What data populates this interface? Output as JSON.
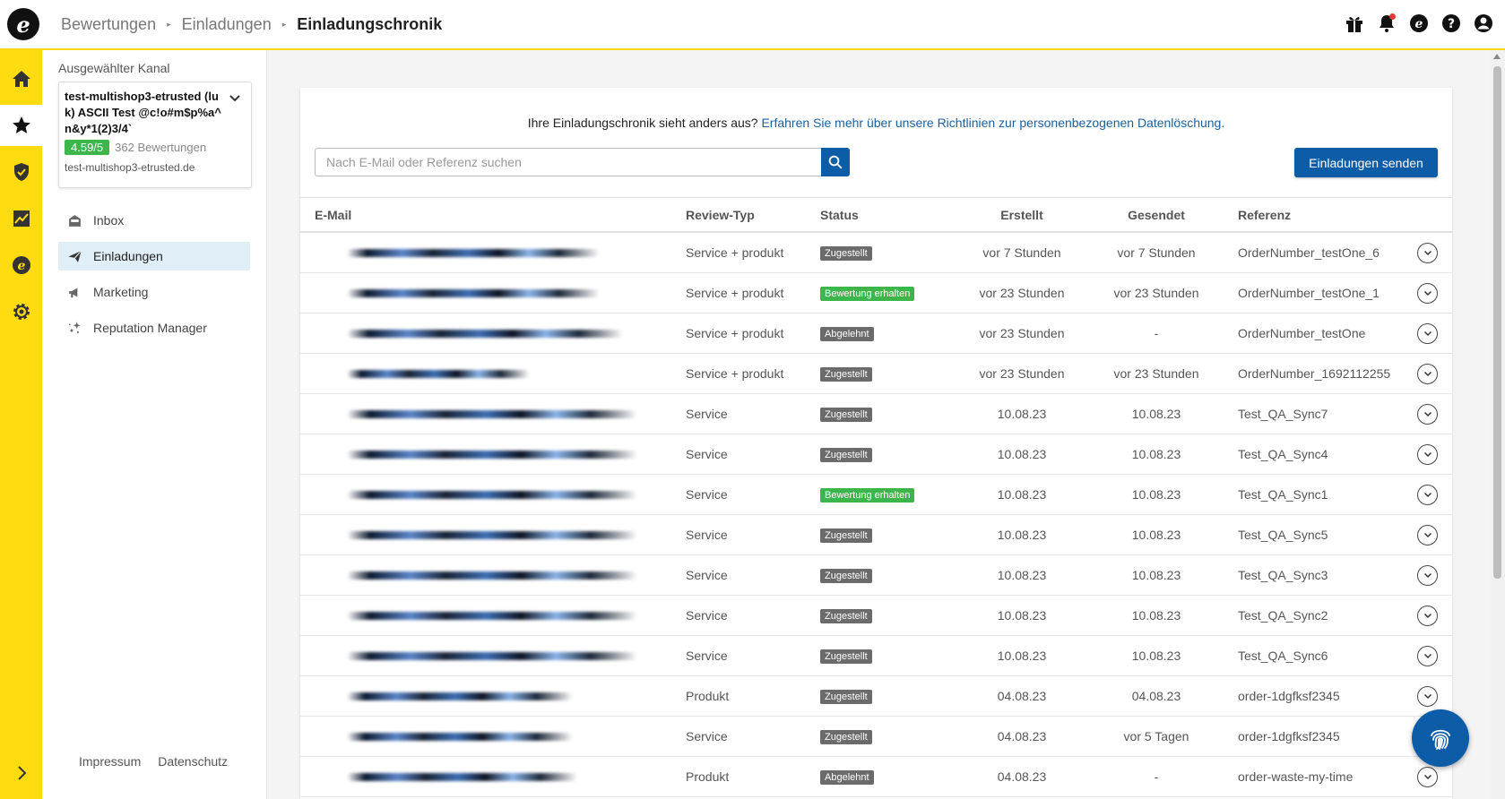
{
  "breadcrumb": [
    "Bewertungen",
    "Einladungen",
    "Einladungschronik"
  ],
  "top_icons": [
    "gift-icon",
    "bell-icon",
    "etrusted-icon",
    "help-icon",
    "user-icon"
  ],
  "rail": [
    "home-icon",
    "star-icon",
    "shield-icon",
    "chart-icon",
    "etrusted-icon",
    "gear-icon"
  ],
  "sidebar": {
    "channel_label": "Ausgewählter Kanal",
    "channel_name": "test-multishop3-etrusted (luk) ASCII Test @c!o#m$p%a^n&y*1(2)3/4`",
    "rating": "4.59/5",
    "rating_count": "362 Bewertungen",
    "channel_url": "test-multishop3-etrusted.de",
    "nav": [
      {
        "label": "Inbox",
        "icon": "inbox-icon"
      },
      {
        "label": "Einladungen",
        "icon": "paper-plane-icon"
      },
      {
        "label": "Marketing",
        "icon": "megaphone-icon"
      },
      {
        "label": "Reputation Manager",
        "icon": "sparkle-icon"
      }
    ],
    "footer": [
      "Impressum",
      "Datenschutz"
    ]
  },
  "main": {
    "notice_text": "Ihre Einladungschronik sieht anders aus?",
    "notice_link": "Erfahren Sie mehr über unsere Richtlinien zur personenbezogenen Datenlöschung.",
    "search_placeholder": "Nach E-Mail oder Referenz suchen",
    "send_button": "Einladungen senden",
    "columns": [
      "E-Mail",
      "Review-Typ",
      "Status",
      "Erstellt",
      "Gesendet",
      "Referenz"
    ],
    "rows": [
      {
        "type": "Service + produkt",
        "status": "Zugestellt",
        "created": "vor 7 Stunden",
        "sent": "vor 7 Stunden",
        "ref": "OrderNumber_testOne_6"
      },
      {
        "type": "Service + produkt",
        "status": "Bewertung erhalten",
        "created": "vor 23 Stunden",
        "sent": "vor 23 Stunden",
        "ref": "OrderNumber_testOne_1"
      },
      {
        "type": "Service + produkt",
        "status": "Abgelehnt",
        "created": "vor 23 Stunden",
        "sent": "-",
        "ref": "OrderNumber_testOne"
      },
      {
        "type": "Service + produkt",
        "status": "Zugestellt",
        "created": "vor 23 Stunden",
        "sent": "vor 23 Stunden",
        "ref": "OrderNumber_1692112255"
      },
      {
        "type": "Service",
        "status": "Zugestellt",
        "created": "10.08.23",
        "sent": "10.08.23",
        "ref": "Test_QA_Sync7"
      },
      {
        "type": "Service",
        "status": "Zugestellt",
        "created": "10.08.23",
        "sent": "10.08.23",
        "ref": "Test_QA_Sync4"
      },
      {
        "type": "Service",
        "status": "Bewertung erhalten",
        "created": "10.08.23",
        "sent": "10.08.23",
        "ref": "Test_QA_Sync1"
      },
      {
        "type": "Service",
        "status": "Zugestellt",
        "created": "10.08.23",
        "sent": "10.08.23",
        "ref": "Test_QA_Sync5"
      },
      {
        "type": "Service",
        "status": "Zugestellt",
        "created": "10.08.23",
        "sent": "10.08.23",
        "ref": "Test_QA_Sync3"
      },
      {
        "type": "Service",
        "status": "Zugestellt",
        "created": "10.08.23",
        "sent": "10.08.23",
        "ref": "Test_QA_Sync2"
      },
      {
        "type": "Service",
        "status": "Zugestellt",
        "created": "10.08.23",
        "sent": "10.08.23",
        "ref": "Test_QA_Sync6"
      },
      {
        "type": "Produkt",
        "status": "Zugestellt",
        "created": "04.08.23",
        "sent": "04.08.23",
        "ref": "order-1dgfksf2345"
      },
      {
        "type": "Service",
        "status": "Zugestellt",
        "created": "04.08.23",
        "sent": "vor 5 Tagen",
        "ref": "order-1dgfksf2345"
      },
      {
        "type": "Produkt",
        "status": "Abgelehnt",
        "created": "04.08.23",
        "sent": "-",
        "ref": "order-waste-my-time"
      }
    ]
  },
  "colors": {
    "brand_yellow": "#ffdc0f",
    "primary_blue": "#0c5ca8",
    "success_green": "#3cb54a",
    "neutral_badge": "#6b6b6b"
  },
  "fab_icon": "fingerprint-icon"
}
